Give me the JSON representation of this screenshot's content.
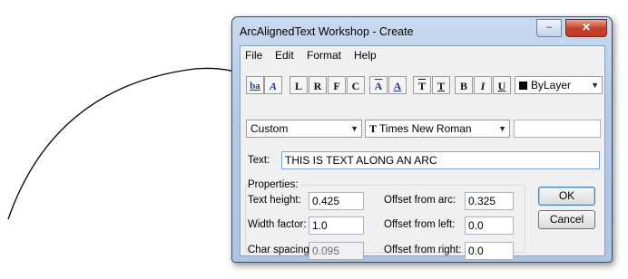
{
  "window": {
    "title": "ArcAlignedText Workshop - Create",
    "close_glyph": "✕",
    "min_glyph": "–",
    "max_glyph": "□"
  },
  "menu": [
    "File",
    "Edit",
    "Format",
    "Help"
  ],
  "toolbar": {
    "buttons": [
      {
        "icon": "text-direction-icon",
        "glyph": "ba"
      },
      {
        "icon": "text-along-arc-icon",
        "glyph": "A"
      },
      {
        "icon": "align-left-icon",
        "glyph": "L"
      },
      {
        "icon": "align-right-icon",
        "glyph": "R"
      },
      {
        "icon": "align-fit-icon",
        "glyph": "F"
      },
      {
        "icon": "align-center-icon",
        "glyph": "C"
      },
      {
        "icon": "text-outside-arc-icon",
        "glyph": "A"
      },
      {
        "icon": "text-inside-arc-icon",
        "glyph": "A"
      },
      {
        "icon": "text-outward-icon",
        "glyph": "T"
      },
      {
        "icon": "text-inward-icon",
        "glyph": "T"
      },
      {
        "icon": "bold-icon",
        "glyph": "B"
      },
      {
        "icon": "italic-icon",
        "glyph": "I"
      },
      {
        "icon": "underline-icon",
        "glyph": "U"
      }
    ],
    "color_value": "ByLayer",
    "color_swatch": "#000000",
    "style_value": "Custom",
    "font_value": "Times New Roman",
    "font_icon_glyph": "T",
    "extra_value": ""
  },
  "text_row": {
    "label": "Text:",
    "value": "THIS IS TEXT ALONG AN ARC"
  },
  "properties": {
    "legend": "Properties:",
    "text_height": {
      "label": "Text height:",
      "value": "0.425"
    },
    "width_factor": {
      "label": "Width factor:",
      "value": "1.0"
    },
    "char_spacing": {
      "label": "Char spacing:",
      "value": "0.095"
    },
    "offset_arc": {
      "label": "Offset from arc:",
      "value": "0.325"
    },
    "offset_left": {
      "label": "Offset from left:",
      "value": "0.0"
    },
    "offset_right": {
      "label": "Offset from right:",
      "value": "0.0"
    }
  },
  "buttons": {
    "ok": "OK",
    "cancel": "Cancel"
  },
  "colors": {
    "accent": "#1f3f8f",
    "titlebar": "#b9cde8",
    "close": "#c7422b"
  }
}
